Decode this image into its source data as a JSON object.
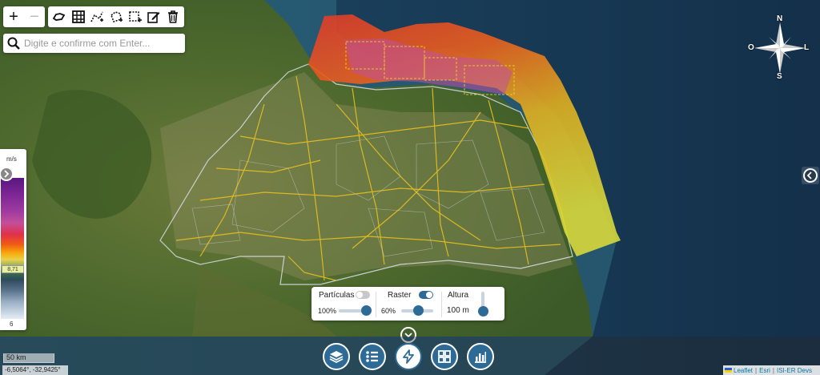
{
  "map": {
    "zoom_in_label": "+",
    "zoom_out_label": "−",
    "search_placeholder": "Digite e confirme com Enter...",
    "compass": {
      "north": "N",
      "south": "S",
      "east": "L",
      "west": "O"
    },
    "scale_label": "50 km",
    "coordinates": "-6,5064°, -32,9425°"
  },
  "legend": {
    "unit": "m/s",
    "current_value": "8,71",
    "min_value": "6",
    "colors": [
      "#5a1680",
      "#a03ba0",
      "#e0304a",
      "#ef5a15",
      "#f7a60a",
      "#e8d14a",
      "#3e6f45",
      "#2d4a5c",
      "#9ab0c4",
      "#e4edf4"
    ]
  },
  "layer_panel": {
    "particles": {
      "label": "Partículas",
      "enabled": false,
      "opacity": "100%",
      "opacity_value": 1.0
    },
    "raster": {
      "label": "Raster",
      "enabled": true,
      "opacity": "60%",
      "opacity_value": 0.6
    },
    "height": {
      "label": "Altura",
      "value": "100 m"
    }
  },
  "bottom_toolbar": {
    "buttons": [
      "layers-icon",
      "list-icon",
      "lightning-icon",
      "grid-icon",
      "chart-icon"
    ],
    "active": "lightning-icon"
  },
  "attribution": {
    "leaflet": "Leaflet",
    "esri": "Esri",
    "isi": "ISI-ER Devs"
  },
  "colors": {
    "accent": "#2d6a96",
    "toggle_on": "#2d6a96",
    "toggle_off": "#c8c8c8"
  }
}
